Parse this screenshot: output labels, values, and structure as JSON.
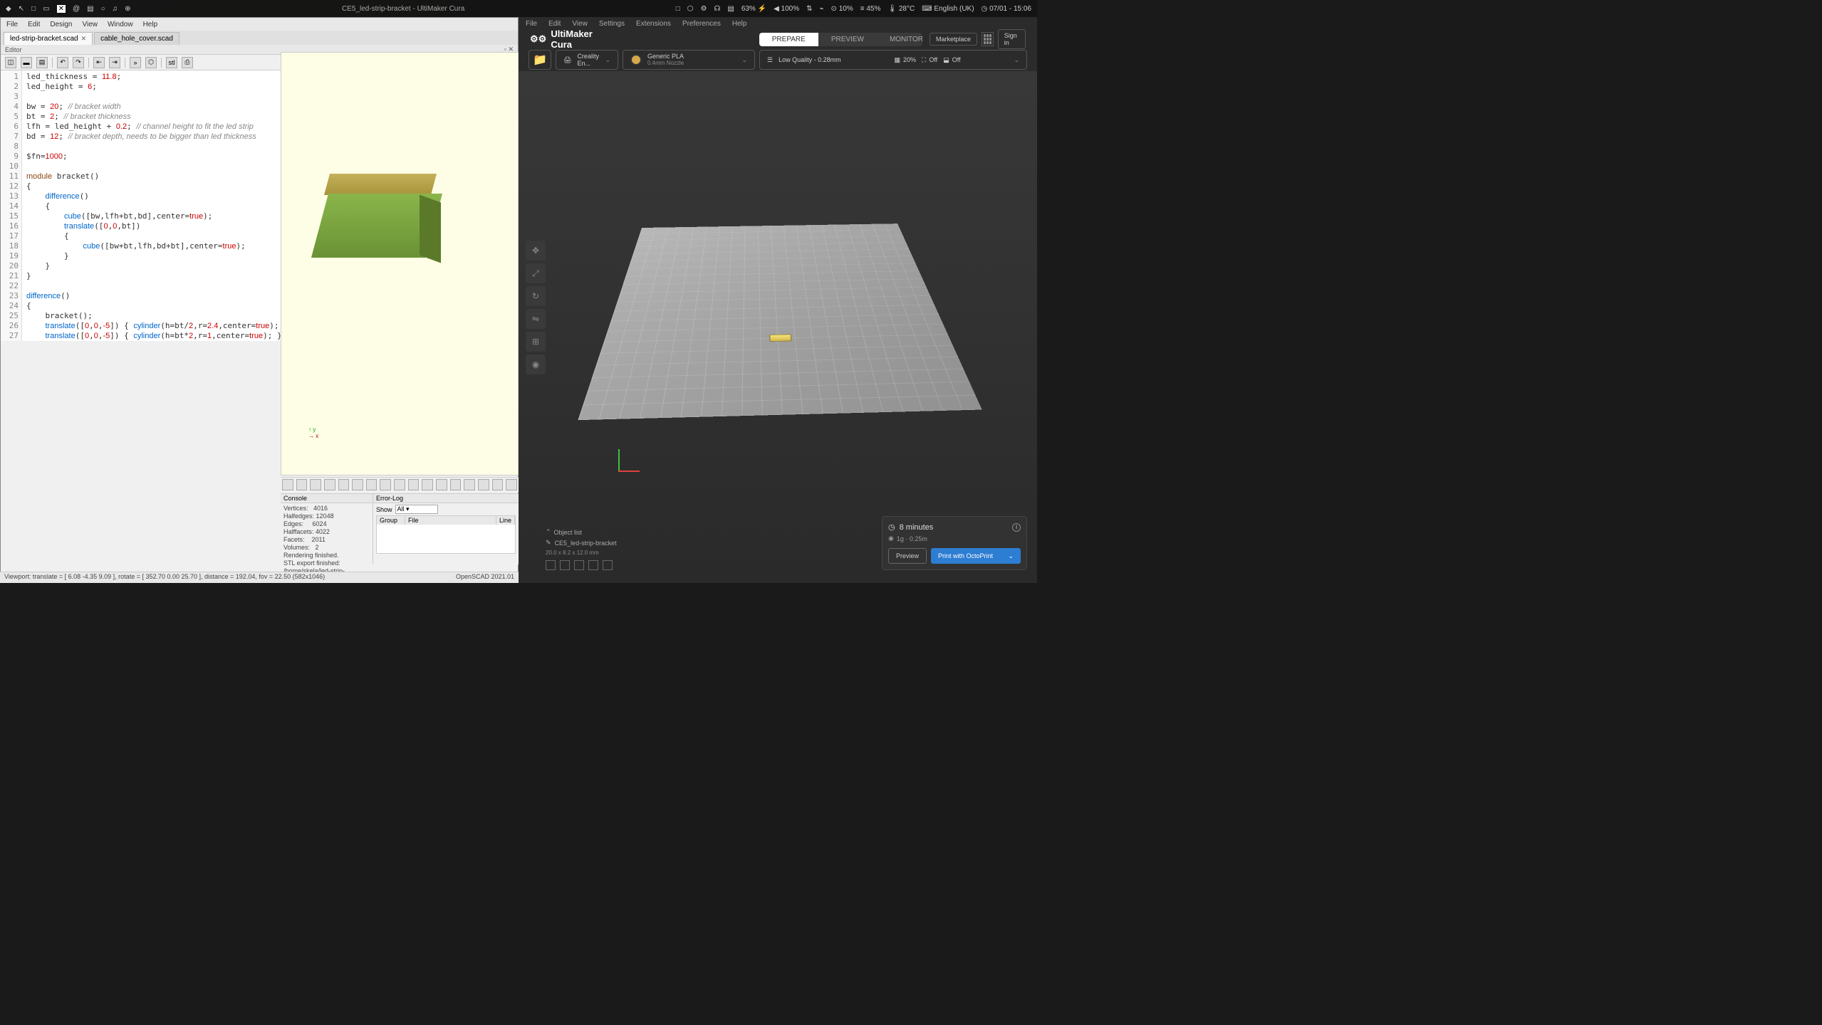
{
  "topbar": {
    "title": "CE5_led-strip-bracket - UltiMaker Cura",
    "battery": "63%",
    "volume": "100%",
    "cpu": "10%",
    "memory": "45%",
    "temp": "28°C",
    "lang": "English (UK)",
    "time": "07/01 - 15:06"
  },
  "openscad": {
    "menu": {
      "file": "File",
      "edit": "Edit",
      "design": "Design",
      "view": "View",
      "window": "Window",
      "help": "Help"
    },
    "tabs": {
      "active": "led-strip-bracket.scad",
      "inactive": "cable_hole_cover.scad"
    },
    "editor_label": "Editor",
    "code_lines": [
      "led_thickness = 11.8;",
      "led_height = 6;",
      "",
      "bw = 20; // bracket width",
      "bt = 2; // bracket thickness",
      "lfh = led_height + 0.2; // channel height to fit the led strip",
      "bd = 12; // bracket depth, needs to be bigger than led thickness",
      "",
      "$fn=1000;",
      "",
      "module bracket()",
      "{",
      "    difference()",
      "    {",
      "        cube([bw,lfh+bt,bd],center=true);",
      "        translate([0,0,bt])",
      "        {",
      "            cube([bw+bt,lfh,bd+bt],center=true);",
      "        }",
      "    }",
      "}",
      "",
      "difference()",
      "{",
      "    bracket();",
      "    translate([0,0,-5]) { cylinder(h=bt/2,r=2.4,center=true); }",
      "    translate([0,0,-5]) { cylinder(h=bt*2,r=1,center=true); }",
      "}"
    ],
    "console": {
      "title": "Console",
      "vertices_label": "Vertices:",
      "vertices": "4016",
      "halfedges_label": "Halfedges:",
      "halfedges": "12048",
      "edges_label": "Edges:",
      "edges": "6024",
      "halffacets_label": "Halffacets:",
      "halffacets": "4022",
      "facets_label": "Facets:",
      "facets": "2011",
      "volumes_label": "Volumes:",
      "volumes": "2",
      "rendering": "Rendering finished.",
      "export": "STL export finished: /home/skela/led-strip-bracket.stl"
    },
    "errorlog": {
      "title": "Error-Log",
      "show_label": "Show",
      "show_value": "All",
      "cols": {
        "group": "Group",
        "file": "File",
        "line": "Line"
      }
    },
    "statusbar": {
      "left": "Viewport: translate = [ 6.08 -4.35 9.09 ], rotate = [ 352.70 0.00 25.70 ], distance = 192.04, fov = 22.50 (582x1046)",
      "right": "OpenSCAD 2021.01"
    }
  },
  "cura": {
    "menu": {
      "file": "File",
      "edit": "Edit",
      "view": "View",
      "settings": "Settings",
      "extensions": "Extensions",
      "preferences": "Preferences",
      "help": "Help"
    },
    "logo": "UltiMaker Cura",
    "tabs": {
      "prepare": "PREPARE",
      "preview": "PREVIEW",
      "monitor": "MONITOR"
    },
    "header_buttons": {
      "marketplace": "Marketplace",
      "signin": "Sign in"
    },
    "settings": {
      "printer": "Creality En...",
      "material_name": "Generic PLA",
      "material_nozzle": "0.4mm Nozzle",
      "quality": "Low Quality - 0.28mm",
      "infill_pct": "20%",
      "support": "Off",
      "adhesion": "Off"
    },
    "object_panel": {
      "title": "Object list",
      "object_name": "CE5_led-strip-bracket",
      "dimensions": "20.0 x 8.2 x 12.0 mm"
    },
    "result": {
      "time": "8 minutes",
      "material": "1g · 0.25m",
      "preview_btn": "Preview",
      "print_btn": "Print with OctoPrint"
    }
  }
}
